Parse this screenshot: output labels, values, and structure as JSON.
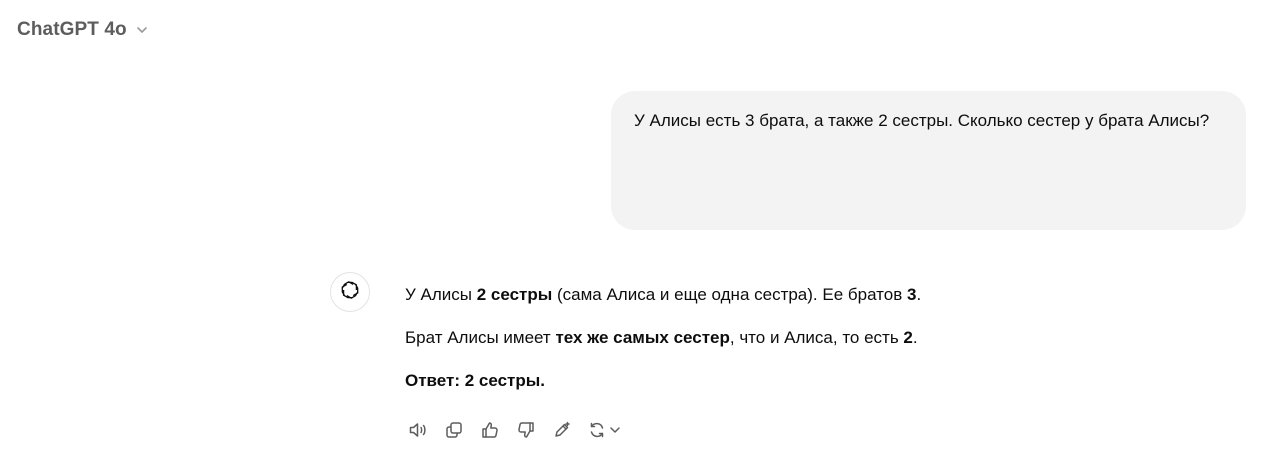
{
  "header": {
    "model_name": "ChatGPT 4o"
  },
  "conversation": {
    "user_message": "У Алисы есть 3 брата, а также 2 сестры. Сколько сестер у брата Алисы?",
    "assistant": {
      "p1": {
        "t1": "У Алисы ",
        "b1": "2 сестры",
        "t2": " (сама Алиса и еще одна сестра). Ее братов ",
        "b2": "3",
        "t3": "."
      },
      "p2": {
        "t1": "Брат Алисы имеет ",
        "b1": "тех же самых сестер",
        "t2": ", что и Алиса, то есть ",
        "b2": "2",
        "t3": "."
      },
      "p3": {
        "b1": "Ответ: 2 сестры."
      }
    }
  },
  "actions": {
    "icons": [
      "read-aloud-icon",
      "copy-icon",
      "thumbs-up-icon",
      "thumbs-down-icon",
      "edit-icon",
      "regenerate-icon"
    ]
  },
  "colors": {
    "user_bubble_bg": "#f3f3f3",
    "model_name_text": "#5d5d5d",
    "icon_color": "#5d5d5d"
  }
}
